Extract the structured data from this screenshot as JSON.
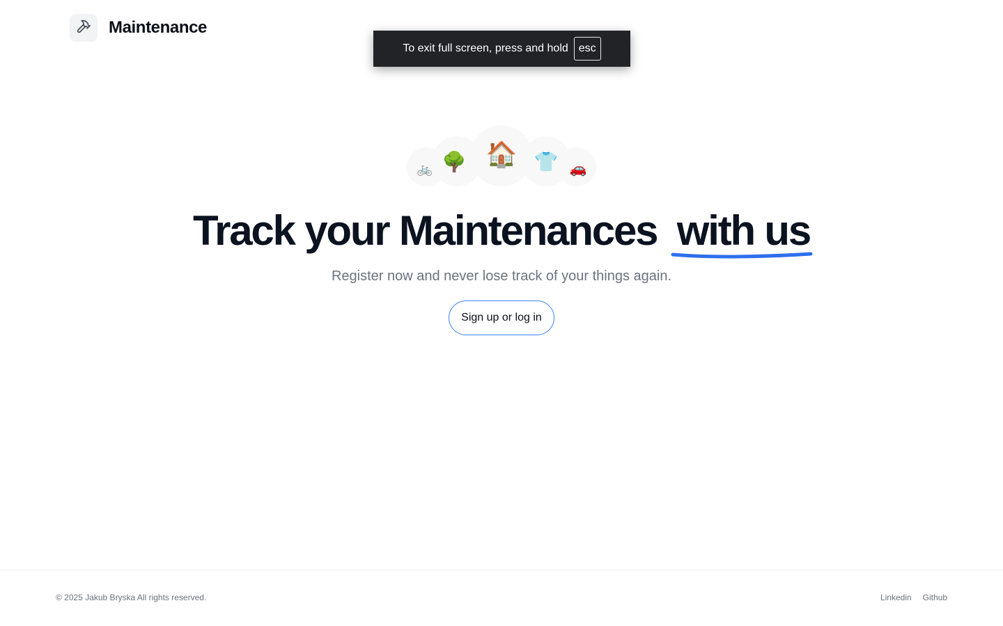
{
  "header": {
    "logo_icon": "hammer-icon",
    "title": "Maintenance"
  },
  "fullscreen_notice": {
    "text": "To exit full screen, press and hold",
    "key": "esc"
  },
  "hero": {
    "emojis": [
      {
        "name": "bicycle",
        "glyph": "🚲"
      },
      {
        "name": "tree",
        "glyph": "🌳"
      },
      {
        "name": "house",
        "glyph": "🏠"
      },
      {
        "name": "shirt",
        "glyph": "👕"
      },
      {
        "name": "car",
        "glyph": "🚗"
      }
    ],
    "headline_main": "Track your Maintenances",
    "headline_accent": "with us",
    "accent_color": "#2f6fed",
    "subtitle": "Register now and never lose track of your things again.",
    "cta_label": "Sign up or log in"
  },
  "footer": {
    "copyright": "© 2025 Jakub Bryska All rights reserved.",
    "links": [
      "Linkedin",
      "Github"
    ]
  }
}
